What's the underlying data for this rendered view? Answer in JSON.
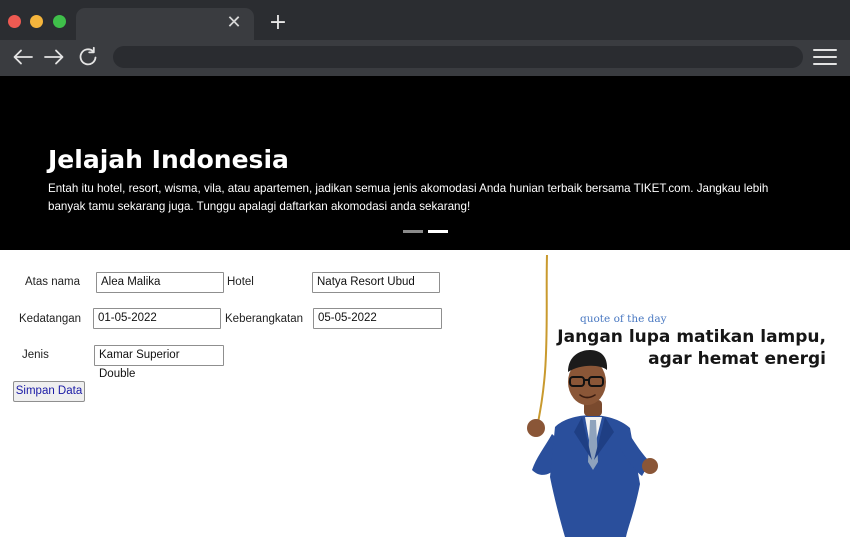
{
  "browser": {
    "tab_close_glyph": "✕",
    "new_tab_glyph": "+",
    "icons": [
      "back-arrow-icon",
      "forward-arrow-icon",
      "reload-icon",
      "hamburger-menu-icon"
    ]
  },
  "hero": {
    "title": "Jelajah Indonesia",
    "description": "Entah itu hotel, resort, wisma, vila, atau apartemen, jadikan semua jenis akomodasi Anda hunian terbaik bersama TIKET.com. Jangkau lebih banyak tamu sekarang juga. Tunggu apalagi daftarkan akomodasi anda sekarang!",
    "carousel": {
      "slides": 2,
      "active": 2
    }
  },
  "form": {
    "atas_nama_label": "Atas nama",
    "atas_nama_value": "Alea Malika",
    "hotel_label": "Hotel",
    "hotel_value": "Natya Resort Ubud",
    "kedatangan_label": "Kedatangan",
    "kedatangan_value": "01-05-2022",
    "keberangkatan_label": "Keberangkatan",
    "keberangkatan_value": "05-05-2022",
    "jenis_label": "Jenis",
    "jenis_value": "Kamar Superior Double",
    "submit_label": "Simpan Data"
  },
  "quote": {
    "small": "quote of the day",
    "line1": "Jangan lupa matikan lampu,",
    "line2": "agar hemat energi"
  },
  "colors": {
    "tabbar": "#2b2d31",
    "toolbar": "#3a3c40",
    "hero_bg": "#000000",
    "quote_accent": "#4a79c2",
    "suit": "#2a4f9c"
  }
}
